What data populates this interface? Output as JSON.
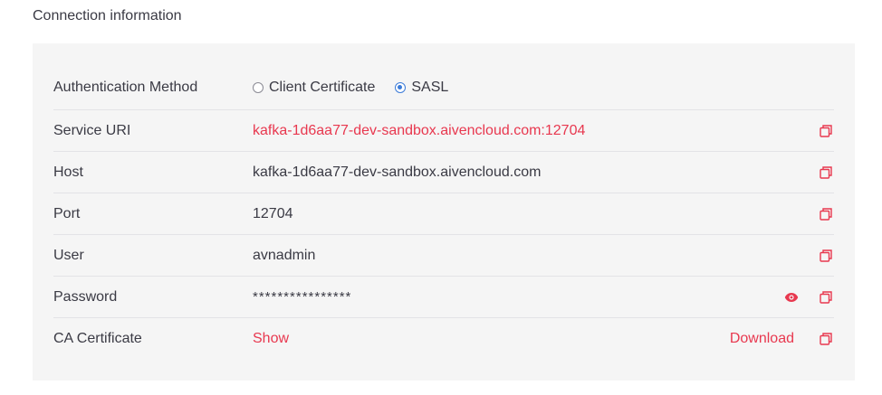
{
  "section": {
    "title": "Connection information"
  },
  "auth": {
    "label": "Authentication Method",
    "options": [
      {
        "label": "Client Certificate",
        "selected": false
      },
      {
        "label": "SASL",
        "selected": true
      }
    ]
  },
  "rows": {
    "service_uri": {
      "label": "Service URI",
      "value": "kafka-1d6aa77-dev-sandbox.aivencloud.com:12704"
    },
    "host": {
      "label": "Host",
      "value": "kafka-1d6aa77-dev-sandbox.aivencloud.com"
    },
    "port": {
      "label": "Port",
      "value": "12704"
    },
    "user": {
      "label": "User",
      "value": "avnadmin"
    },
    "password": {
      "label": "Password",
      "value": "****************"
    },
    "ca_certificate": {
      "label": "CA Certificate",
      "show_label": "Show",
      "download_label": "Download"
    }
  },
  "icons": {
    "copy": "copy-icon",
    "reveal": "eye-icon"
  },
  "colors": {
    "accent": "#e8384f",
    "radio_selected": "#3b7bd8",
    "panel_bg": "#f5f5f5"
  }
}
